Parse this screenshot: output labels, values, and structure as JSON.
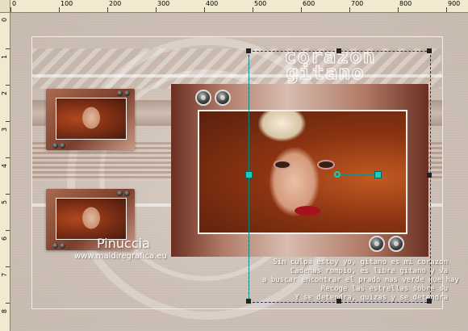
{
  "ruler": {
    "top_labels": [
      "0",
      "100",
      "200",
      "300",
      "400",
      "500",
      "600",
      "700",
      "800",
      "900"
    ],
    "left_labels": [
      "0",
      "1",
      "2",
      "3",
      "4",
      "5",
      "6",
      "7",
      "8"
    ]
  },
  "art": {
    "title_line1": "corazon",
    "title_line2": "gitano",
    "watermark_name": "Pinuccia",
    "watermark_url": "www.maidiregrafica.eu",
    "poem_lines": [
      "Sin culpa estoy yo, gitano es mi corazon",
      "Cadenas rompio, es libre gitano y va",
      "a buscar encontrar el prado mas verde que hay",
      "Recoge las estrellas sobre su",
      "Y se detendra, quizas y se detendra"
    ]
  },
  "tool": {
    "guide_color": "#11d1b6",
    "handle_color": "#222222"
  }
}
